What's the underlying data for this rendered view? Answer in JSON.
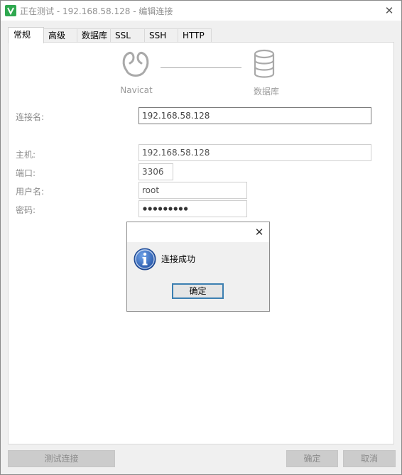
{
  "window": {
    "title": "正在测试 - 192.168.58.128 - 编辑连接",
    "close_icon": "close-icon",
    "app_icon": "navicat-app-icon"
  },
  "tabs": [
    {
      "label": "常规",
      "active": true
    },
    {
      "label": "高级",
      "active": false
    },
    {
      "label": "数据库",
      "active": false
    },
    {
      "label": "SSL",
      "active": false
    },
    {
      "label": "SSH",
      "active": false
    },
    {
      "label": "HTTP",
      "active": false
    }
  ],
  "graphic": {
    "left_label": "Navicat",
    "right_label": "数据库",
    "left_icon": "navicat-logo-icon",
    "right_icon": "database-icon"
  },
  "form": {
    "connection_name": {
      "label": "连接名:",
      "value": "192.168.58.128"
    },
    "host": {
      "label": "主机:",
      "value": "192.168.58.128"
    },
    "port": {
      "label": "端口:",
      "value": "3306"
    },
    "username": {
      "label": "用户名:",
      "value": "root"
    },
    "password": {
      "label": "密码:",
      "masked_length": 9
    }
  },
  "message_box": {
    "text": "连接成功",
    "ok_label": "确定",
    "icon": "info-icon",
    "close_icon": "close-icon"
  },
  "buttons": {
    "test": "测试连接",
    "ok": "确定",
    "cancel": "取消"
  },
  "colors": {
    "navicat_green": "#2fa84f",
    "info_blue": "#1f5fb8",
    "focus_border": "#3c7fb1"
  }
}
